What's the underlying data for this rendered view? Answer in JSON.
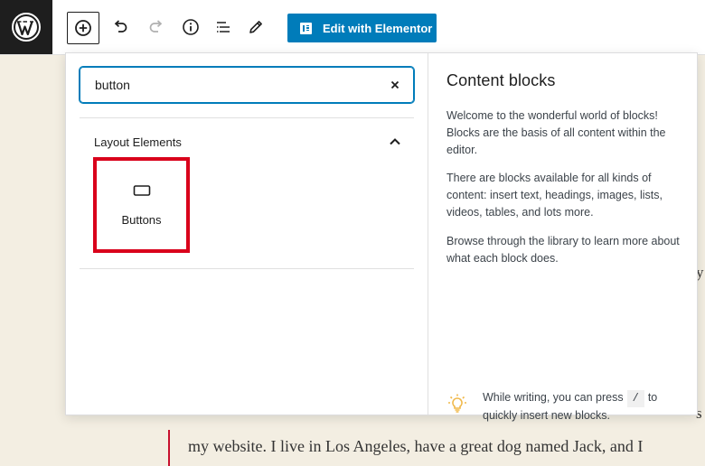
{
  "toolbar": {
    "elementor_label": "Edit with Elementor",
    "icons": [
      "wordpress-logo",
      "add-block-icon",
      "undo-icon",
      "redo-icon",
      "info-icon",
      "list-view-icon",
      "pencil-icon"
    ]
  },
  "inserter": {
    "search_value": "button",
    "category": "Layout Elements",
    "blocks": [
      {
        "label": "Buttons",
        "icon": "button-block-icon"
      }
    ]
  },
  "info_panel": {
    "title": "Content blocks",
    "paragraphs": [
      "Welcome to the wonderful world of blocks! Blocks are the basis of all content within the editor.",
      "There are blocks available for all kinds of content: insert text, headings, images, lists, videos, tables, and lots more.",
      "Browse through the library to learn more about what each block does."
    ],
    "tip_before": "While writing, you can press",
    "tip_key": "/",
    "tip_after": "to quickly insert new blocks."
  },
  "editor": {
    "visible_line": "my website. I live in Los Angeles, have a great dog named Jack, and I",
    "fragment_1": "y",
    "fragment_2": "s"
  },
  "colors": {
    "accent": "#007cba",
    "highlight": "#d9001b",
    "tip_bulb": "#f0b849"
  }
}
